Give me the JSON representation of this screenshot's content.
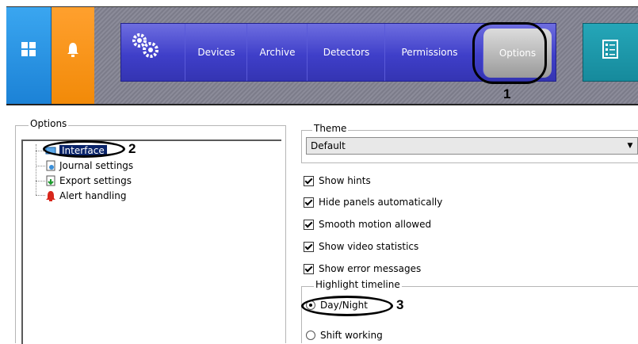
{
  "top_panel": {
    "menu_items": [
      {
        "label": "Devices"
      },
      {
        "label": "Archive"
      },
      {
        "label": "Detectors"
      },
      {
        "label": "Permissions"
      },
      {
        "label": "Options"
      }
    ],
    "selected_item": "Options"
  },
  "options": {
    "group_title": "Options",
    "tree": [
      {
        "label": "Interface",
        "icon": "interface-icon",
        "selected": true
      },
      {
        "label": "Journal settings",
        "icon": "journal-icon"
      },
      {
        "label": "Export settings",
        "icon": "export-icon"
      },
      {
        "label": "Alert handling",
        "icon": "alert-icon"
      }
    ]
  },
  "settings": {
    "theme_title": "Theme",
    "theme_value": "Default",
    "checkboxes": [
      {
        "label": "Show hints",
        "checked": true
      },
      {
        "label": "Hide panels automatically",
        "checked": true
      },
      {
        "label": "Smooth motion allowed",
        "checked": true
      },
      {
        "label": "Show video statistics",
        "checked": true
      },
      {
        "label": "Show error messages",
        "checked": true
      }
    ],
    "highlight_title": "Highlight timeline",
    "radios": [
      {
        "label": "Day/Night",
        "checked": true
      },
      {
        "label": "Shift working",
        "checked": false
      }
    ]
  },
  "callouts": [
    "1",
    "2",
    "3"
  ],
  "colors": {
    "menu_bar": "#4545cc",
    "windows_tile": "#2a93e3",
    "bell_tile": "#f7920f",
    "teal_tile": "#1e98aa",
    "selection": "#0a246a"
  }
}
